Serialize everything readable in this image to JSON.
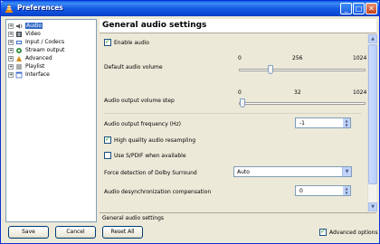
{
  "window": {
    "title": "Preferences"
  },
  "titlebar_buttons": {
    "minimize": "_",
    "maximize": "□",
    "close": "✕"
  },
  "tree": {
    "items": [
      {
        "label": "Audio",
        "icon": "speaker-icon",
        "expander": "+"
      },
      {
        "label": "Video",
        "icon": "film-icon",
        "expander": "+"
      },
      {
        "label": "Input / Codecs",
        "icon": "input-icon",
        "expander": "+"
      },
      {
        "label": "Stream output",
        "icon": "stream-icon",
        "expander": "+"
      },
      {
        "label": "Advanced",
        "icon": "advanced-icon",
        "expander": "+"
      },
      {
        "label": "Playlist",
        "icon": "playlist-icon",
        "expander": "+"
      },
      {
        "label": "Interface",
        "icon": "interface-icon",
        "expander": "+"
      }
    ]
  },
  "panel": {
    "title": "General audio settings",
    "enable_audio": {
      "label": "Enable audio",
      "checked": true
    },
    "default_volume": {
      "label": "Default audio volume",
      "min": "0",
      "mid": "256",
      "max": "1024",
      "value": 256
    },
    "output_step": {
      "label": "Audio output volume step",
      "min": "0",
      "mid": "32",
      "max": "1024",
      "value": 32
    },
    "frequency": {
      "label": "Audio output frequency (Hz)",
      "value": "-1"
    },
    "resampling": {
      "label": "High quality audio resampling",
      "checked": true
    },
    "spdif": {
      "label": "Use S/PDIF when available",
      "checked": false
    },
    "dolby": {
      "label": "Force detection of Dolby Surround",
      "value": "Auto"
    },
    "desync": {
      "label": "Audio desynchronization compensation",
      "value": "0"
    },
    "status": "General audio settings"
  },
  "buttons": {
    "save": "Save",
    "cancel": "Cancel",
    "reset": "Reset All"
  },
  "advanced_options": {
    "label": "Advanced options",
    "checked": true
  }
}
